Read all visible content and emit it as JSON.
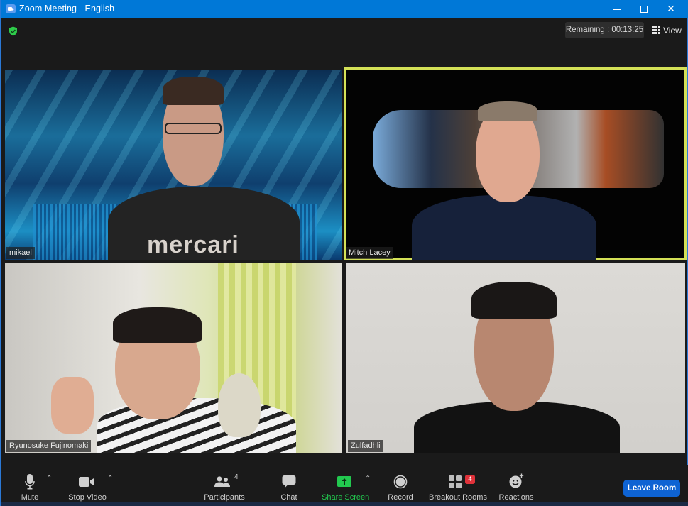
{
  "window": {
    "title": "Zoom Meeting - English",
    "controls": {
      "minimize": "minimize",
      "maximize": "maximize",
      "close": "close"
    }
  },
  "header": {
    "security_icon": "shield-check-icon",
    "security_color": "#2ecc4a",
    "timer_text": "Remaining : 00:13:25",
    "view_label": "View",
    "view_icon": "grid-icon"
  },
  "participants": [
    {
      "name": "mikael",
      "active_speaker": false
    },
    {
      "name": "Mitch Lacey",
      "active_speaker": true
    },
    {
      "name": "Ryunosuke Fujinomaki",
      "active_speaker": false
    },
    {
      "name": "Zulfadhli",
      "active_speaker": false
    }
  ],
  "video_labels": {
    "shirt_text": "mercari"
  },
  "toolbar": {
    "mute": {
      "label": "Mute",
      "icon": "microphone-icon"
    },
    "stop_video": {
      "label": "Stop Video",
      "icon": "video-camera-icon"
    },
    "participants": {
      "label": "Participants",
      "icon": "people-icon",
      "count": "4"
    },
    "chat": {
      "label": "Chat",
      "icon": "chat-bubble-icon"
    },
    "share_screen": {
      "label": "Share Screen",
      "icon": "share-arrow-icon",
      "color": "#22c94f"
    },
    "record": {
      "label": "Record",
      "icon": "record-icon"
    },
    "breakout_rooms": {
      "label": "Breakout Rooms",
      "icon": "breakout-grid-icon",
      "count": "4"
    },
    "reactions": {
      "label": "Reactions",
      "icon": "smiley-plus-icon"
    },
    "leave": {
      "label": "Leave Room",
      "color": "#0e63d3"
    }
  },
  "colors": {
    "titlebar": "#0078d7",
    "active_speaker_border": "#d4e157",
    "background": "#1a1a1a"
  }
}
